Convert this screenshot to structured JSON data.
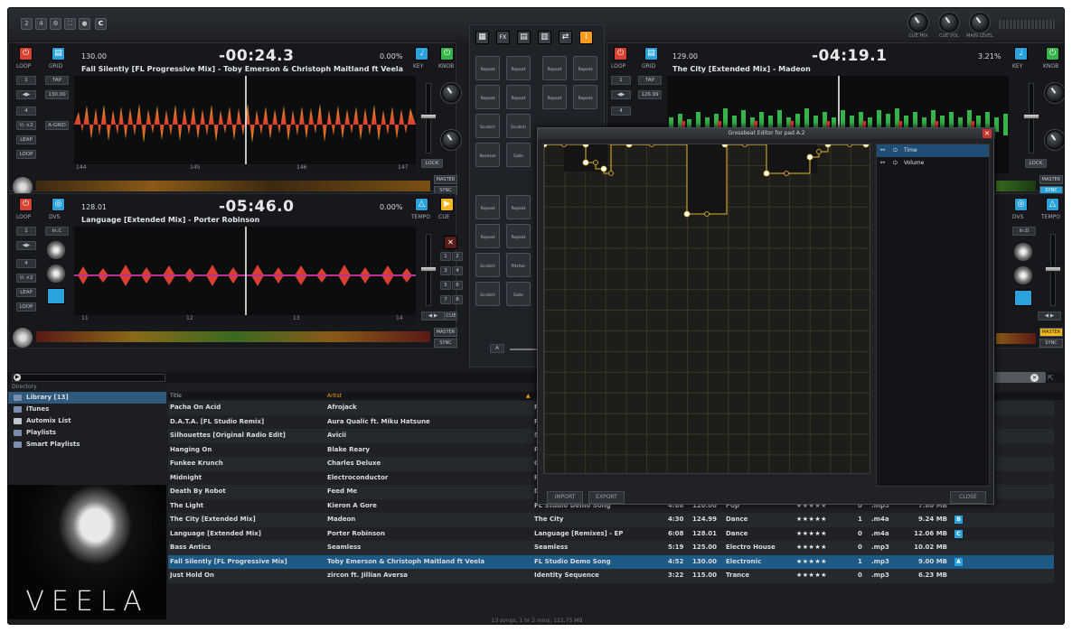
{
  "toolbar": {
    "c_button": "C"
  },
  "master": {
    "knobs": [
      "CUE MIX",
      "CUE VOL",
      "MAIN LEVEL"
    ]
  },
  "center": {
    "tabs": [
      "grid",
      "FX",
      "sampler",
      "pads",
      "mix",
      "grossbeat"
    ],
    "pads": [
      [
        "Repeat",
        "Repeat",
        "Repeat",
        "Repeat"
      ],
      [
        "Repeat",
        "Repeat",
        "Repeat",
        "Repeat"
      ],
      [
        "Scratch",
        "Scratch"
      ],
      [
        "Reverse",
        "Gate"
      ],
      [
        "Repeat",
        "Repeat"
      ],
      [
        "Repeat",
        "Repeat"
      ],
      [
        "Scratch",
        "Pitcher"
      ],
      [
        "Scratch",
        "Gate"
      ]
    ],
    "bottom_label": "A"
  },
  "deck_a": {
    "bpm": "130.00",
    "time": "-00:24.3",
    "pitch": "0.00%",
    "title": "Fall Silently [FL Progressive Mix] - Toby Emerson & Christoph Maitland ft Veela",
    "labels": [
      "LOOP",
      "GRID",
      "KEY",
      "KNOB"
    ],
    "bpm_small": "130.00",
    "tap": "TAP",
    "agrid": "A-GRID",
    "leap": "LEAP",
    "loop_btn": "LOOP",
    "loop_num": [
      "1",
      "4"
    ],
    "ruler": [
      "144",
      "145",
      "146",
      "147"
    ],
    "lock": "LOCK",
    "master": "MASTER",
    "sync": "SYNC"
  },
  "deck_b": {
    "bpm": "129.00",
    "time": "-04:19.1",
    "pitch": "3.21%",
    "title": "The City [Extended Mix] - Madeon",
    "labels": [
      "LOOP",
      "GRID",
      "KEY",
      "KNOB"
    ],
    "bpm_small": "126.99",
    "tap": "TAP",
    "loop_num": [
      "1",
      "4"
    ],
    "lock": "LOCK",
    "master": "MASTER",
    "sync": "SYNC"
  },
  "deck_c": {
    "bpm": "128.01",
    "time": "-05:46.0",
    "pitch": "0.00%",
    "title": "Language [Extended Mix] - Porter Robinson",
    "labels": [
      "LOOP",
      "DVS",
      "TEMPO",
      "CUE"
    ],
    "input": "In.C",
    "leap": "LEAP",
    "loop_btn": "LOOP",
    "loop_num": [
      "1",
      "4"
    ],
    "ruler": [
      "11",
      "12",
      "13",
      "14"
    ],
    "cue": "CUE",
    "master": "MASTER",
    "sync": "SYNC"
  },
  "deck_d": {
    "labels": [
      "DVS",
      "TEMPO"
    ],
    "input": "In.D",
    "master": "MASTER",
    "sync": "SYNC"
  },
  "grossbeat": {
    "title": "Grossbeat Editor for pad A.2",
    "params": [
      "Time",
      "Volume"
    ],
    "import": "IMPORT",
    "export": "EXPORT",
    "close": "CLOSE",
    "close_x": "✕"
  },
  "browser": {
    "directory": "Directory",
    "sidebar": [
      "Library [13]",
      "iTunes",
      "Automix List",
      "Playlists",
      "Smart Playlists"
    ],
    "artwork_text": "VEELA",
    "col_title": "Title",
    "col_artist": "Artist",
    "footer": "13 songs, 1 hr 2 mins, 122.75 MB",
    "search_clear": "✕"
  },
  "tracks": [
    {
      "title": "Pacha On Acid",
      "artist": "Afrojack",
      "album": "F",
      "len": "",
      "bpm": "",
      "genre": "",
      "rating": "",
      "plays": "",
      "ext": "",
      "size": "",
      "tag": ""
    },
    {
      "title": "D.A.T.A. [FL Studio Remix]",
      "artist": "Aura Qualic ft. Miku Hatsune",
      "album": "F",
      "len": "",
      "bpm": "",
      "genre": "",
      "rating": "",
      "plays": "",
      "ext": "",
      "size": "",
      "tag": ""
    },
    {
      "title": "Silhouettes [Original Radio Edit]",
      "artist": "Avicii",
      "album": "S",
      "len": "",
      "bpm": "",
      "genre": "",
      "rating": "",
      "plays": "",
      "ext": "",
      "size": "",
      "tag": ""
    },
    {
      "title": "Hanging On",
      "artist": "Blake Reary",
      "album": "F",
      "len": "",
      "bpm": "",
      "genre": "",
      "rating": "",
      "plays": "",
      "ext": "",
      "size": "",
      "tag": ""
    },
    {
      "title": "Funkee Krunch",
      "artist": "Charles Deluxe",
      "album": "C",
      "len": "",
      "bpm": "",
      "genre": "",
      "rating": "",
      "plays": "",
      "ext": "",
      "size": "",
      "tag": ""
    },
    {
      "title": "Midnight",
      "artist": "Electroconductor",
      "album": "F",
      "len": "",
      "bpm": "",
      "genre": "",
      "rating": "",
      "plays": "",
      "ext": "",
      "size": "",
      "tag": ""
    },
    {
      "title": "Death By Robot",
      "artist": "Feed Me",
      "album": "D",
      "len": "",
      "bpm": "",
      "genre": "",
      "rating": "",
      "plays": "",
      "ext": "",
      "size": "",
      "tag": ""
    },
    {
      "title": "The Light",
      "artist": "Kieron A Gore",
      "album": "FL Studio Demo Song",
      "len": "4:08",
      "bpm": "120.00",
      "genre": "Pop",
      "rating": "★★★★★",
      "plays": "0",
      "ext": ".mp3",
      "size": "7.80 MB",
      "tag": ""
    },
    {
      "title": "The City [Extended Mix]",
      "artist": "Madeon",
      "album": "The City",
      "len": "4:30",
      "bpm": "124.99",
      "genre": "Dance",
      "rating": "★★★★★",
      "plays": "1",
      "ext": ".m4a",
      "size": "9.24 MB",
      "tag": "B"
    },
    {
      "title": "Language [Extended Mix]",
      "artist": "Porter Robinson",
      "album": "Language [Remixes] - EP",
      "len": "6:08",
      "bpm": "128.01",
      "genre": "Dance",
      "rating": "★★★★★",
      "plays": "0",
      "ext": ".m4a",
      "size": "12.06 MB",
      "tag": "C"
    },
    {
      "title": "Bass Antics",
      "artist": "Seamless",
      "album": "Seamless",
      "len": "5:19",
      "bpm": "125.00",
      "genre": "Electro House",
      "rating": "★★★★★",
      "plays": "0",
      "ext": ".mp3",
      "size": "10.02 MB",
      "tag": ""
    },
    {
      "title": "Fall Silently [FL Progressive Mix]",
      "artist": "Toby Emerson & Christoph Maitland ft Veela",
      "album": "FL Studio Demo Song",
      "len": "4:52",
      "bpm": "130.00",
      "genre": "Electronic",
      "rating": "★★★★★",
      "plays": "1",
      "ext": ".mp3",
      "size": "9.00 MB",
      "tag": "A"
    },
    {
      "title": "Just Hold On",
      "artist": "zircon ft. Jillian Aversa",
      "album": "Identity Sequence",
      "len": "3:22",
      "bpm": "115.00",
      "genre": "Trance",
      "rating": "★★★★★",
      "plays": "0",
      "ext": ".mp3",
      "size": "6.23 MB",
      "tag": ""
    }
  ],
  "colors": {
    "accent_blue": "#2aa2dc",
    "red": "#d8402f",
    "green": "#36b44a",
    "yellow": "#f2b81a",
    "orange": "#f59a1a",
    "selected_row": "#1d5a85"
  }
}
